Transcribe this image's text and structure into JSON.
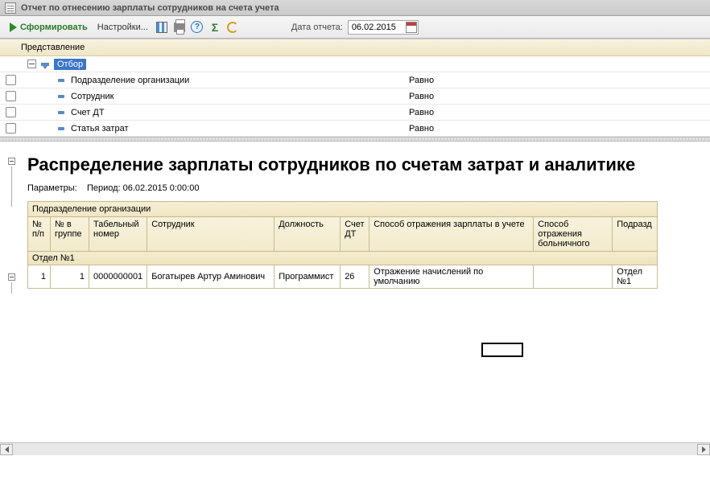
{
  "window": {
    "title": "Отчет по отнесению зарплаты сотрудников на счета учета"
  },
  "toolbar": {
    "generate": "Сформировать",
    "settings": "Настройки...",
    "date_label": "Дата отчета:",
    "date_value": "06.02.2015"
  },
  "filter": {
    "header_col1": "Представление",
    "root": "Отбор",
    "rows": [
      {
        "label": "Подразделение организации",
        "cond": "Равно"
      },
      {
        "label": "Сотрудник",
        "cond": "Равно"
      },
      {
        "label": "Счет ДТ",
        "cond": "Равно"
      },
      {
        "label": "Статья затрат",
        "cond": "Равно"
      }
    ]
  },
  "report": {
    "title": "Распределение зарплаты сотрудников по счетам затрат и аналитике",
    "params_label": "Параметры:",
    "params_value": "Период: 06.02.2015 0:00:00",
    "group_header": "Подразделение организации",
    "columns": {
      "npp": "№ п/п",
      "ngrp": "№ в группе",
      "tabno": "Табельный номер",
      "emp": "Сотрудник",
      "pos": "Должность",
      "acct": "Счет ДТ",
      "refl": "Способ отражения зарплаты в учете",
      "sick": "Способ отражения больничного",
      "dept2": "Подразд"
    },
    "group_row": "Отдел №1",
    "data": {
      "npp": "1",
      "ngrp": "1",
      "tabno": "0000000001",
      "emp": "Богатырев Артур Аминович",
      "pos": "Программист",
      "acct": "26",
      "refl": "Отражение начислений по умолчанию",
      "sick": "",
      "dept2": "Отдел №1"
    }
  }
}
